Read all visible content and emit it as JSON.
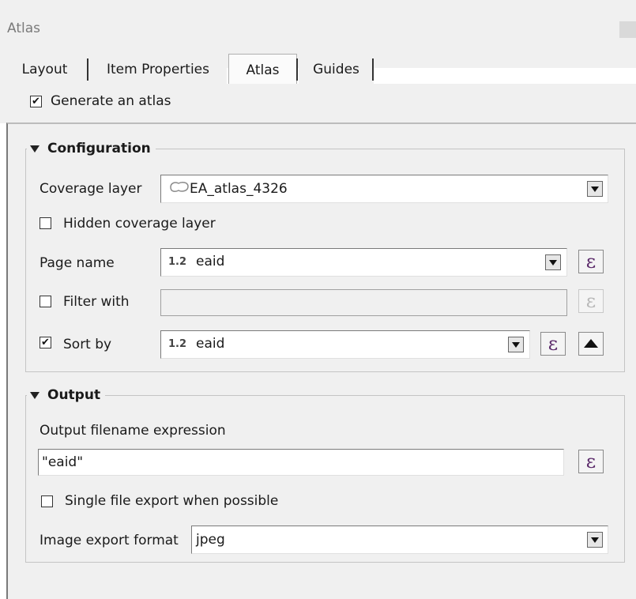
{
  "window": {
    "title": "Atlas"
  },
  "tabs": [
    {
      "label": "Layout",
      "active": false
    },
    {
      "label": "Item Properties",
      "active": false
    },
    {
      "label": "Atlas",
      "active": true
    },
    {
      "label": "Guides",
      "active": false
    }
  ],
  "generate_atlas": {
    "label": "Generate an atlas",
    "checked": true
  },
  "configuration": {
    "title": "Configuration",
    "coverage_layer": {
      "label": "Coverage layer",
      "value": "EA_atlas_4326",
      "icon": "polygon-layer-icon"
    },
    "hidden_coverage": {
      "label": "Hidden coverage layer",
      "checked": false
    },
    "page_name": {
      "label": "Page name",
      "type_badge": "1.2",
      "value": "eaid"
    },
    "filter_with": {
      "label": "Filter with",
      "checked": false,
      "value": ""
    },
    "sort_by": {
      "label": "Sort by",
      "checked": true,
      "type_badge": "1.2",
      "value": "eaid",
      "order_icon": "sort-ascending-icon"
    },
    "expression_symbol": "ε"
  },
  "output": {
    "title": "Output",
    "filename_expression_label": "Output filename expression",
    "filename_expression_value": "\"eaid\"",
    "single_file": {
      "label": "Single file export when possible",
      "checked": false
    },
    "image_format": {
      "label": "Image export format",
      "value": "jpeg"
    }
  },
  "colors": {
    "epsilon": "#5b2a6a",
    "panel_bg": "#f0f0f0"
  }
}
